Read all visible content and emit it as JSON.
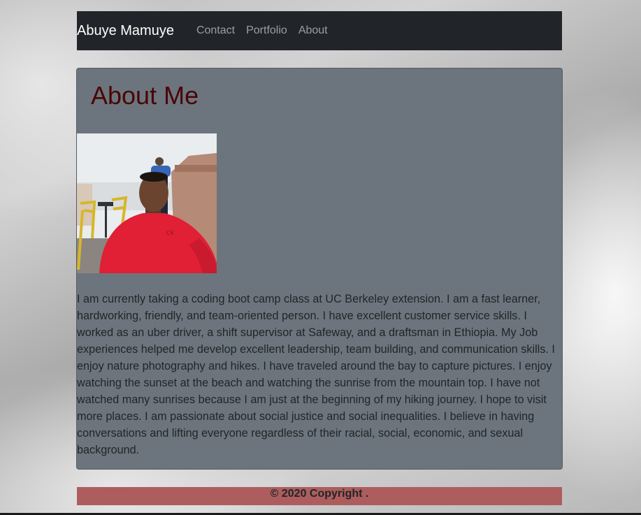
{
  "nav": {
    "brand": "Abuye Mamuye",
    "links": [
      "Contact",
      "Portfolio",
      "About"
    ]
  },
  "about": {
    "title": "About Me",
    "photo_icon": "profile-photo",
    "bio": "I am currently taking a coding boot camp class at UC Berkeley extension. I am a fast learner, hardworking, friendly, and team-oriented person. I have excellent customer service skills. I worked as an uber driver, a shift supervisor at Safeway, and a draftsman in Ethiopia. My Job experiences helped me develop excellent leadership, team building, and communication skills. I enjoy nature photography and hikes. I have traveled around the bay to capture pictures. I enjoy watching the sunset at the beach and watching the sunrise from the mountain top. I have not watched many sunrises because I am just at the beginning of my hiking journey. I hope to visit more places. I am passionate about social justice and social inequalities. I believe in having conversations and lifting everyone regardless of their racial, social, economic, and sexual background."
  },
  "footer": {
    "text": "© 2020 Copyright ."
  },
  "colors": {
    "navbar": "#212529",
    "card": "#6c757d",
    "title": "#4a0505",
    "footer": "#ad5d5d"
  }
}
